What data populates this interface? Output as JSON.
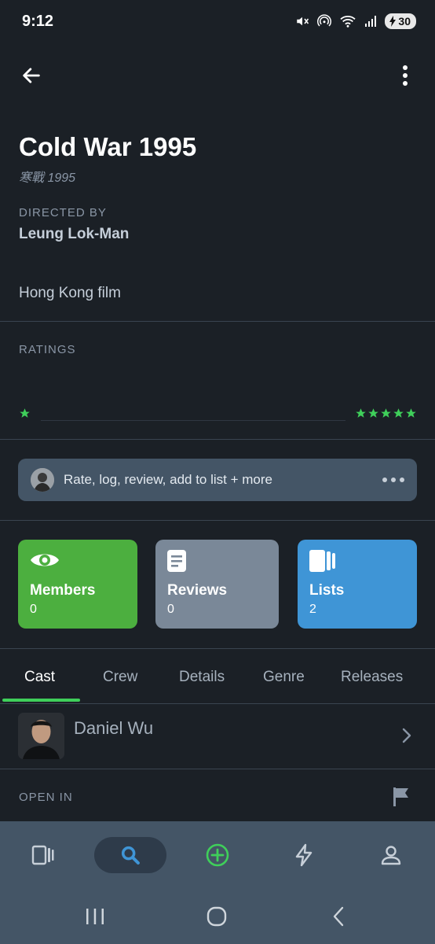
{
  "status_bar": {
    "time": "9:12",
    "battery": "30",
    "icons": [
      "mute-icon",
      "hotspot-icon",
      "wifi-icon",
      "signal-icon",
      "battery-charging-icon"
    ]
  },
  "app_bar": {
    "back_icon": "arrow-left-icon",
    "more_icon": "more-vertical-icon"
  },
  "film": {
    "title": "Cold War 1995",
    "original_title": "寒戰 1995",
    "directed_by_label": "DIRECTED BY",
    "director": "Leung Lok-Man",
    "country": "Hong Kong film"
  },
  "ratings": {
    "label": "RATINGS",
    "accent": "#3fcf5a"
  },
  "action_bar": {
    "text": "Rate, log, review, add to list + more"
  },
  "cards": {
    "members": {
      "title": "Members",
      "count": "0",
      "color": "#4caf3f",
      "icon": "eye-icon"
    },
    "reviews": {
      "title": "Reviews",
      "count": "0",
      "color": "#7a8898",
      "icon": "document-icon"
    },
    "lists": {
      "title": "Lists",
      "count": "2",
      "color": "#3f95d6",
      "icon": "lists-icon"
    }
  },
  "tabs": {
    "cast": "Cast",
    "crew": "Crew",
    "details": "Details",
    "genre": "Genre",
    "releases": "Releases",
    "active": "Cast"
  },
  "cast": [
    {
      "name": "Daniel Wu"
    }
  ],
  "open_in": {
    "label": "OPEN IN"
  },
  "bottom_nav": {
    "items": [
      "films-icon",
      "search-icon",
      "add-icon",
      "activity-icon",
      "profile-icon"
    ],
    "active": "search-icon"
  }
}
